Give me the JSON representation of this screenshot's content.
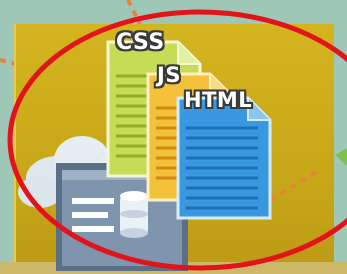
{
  "labels": {
    "css": "CSS",
    "js": "JS",
    "html": "HTML"
  },
  "icons": {
    "css_file": "document-icon",
    "js_file": "document-icon",
    "html_file": "document-icon",
    "cloud": "cloud-icon",
    "server": "database-window-icon",
    "highlight": "red-ellipse"
  },
  "colors": {
    "background": "#9ec7b8",
    "panel": "#d4b41f",
    "css_doc": "#c6dc57",
    "js_doc": "#f3c23a",
    "html_doc": "#3a98e0",
    "highlight": "#e2131b",
    "connector": "#e8833a"
  }
}
